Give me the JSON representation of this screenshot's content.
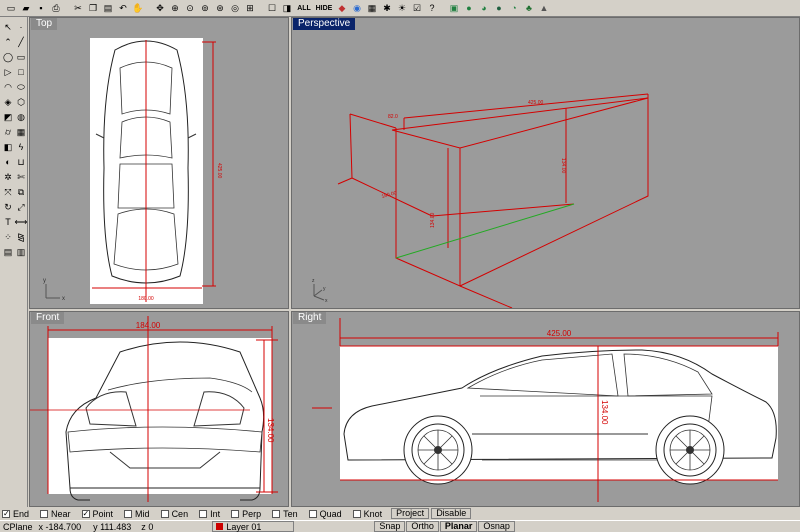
{
  "colors": {
    "accent": "#0a246a",
    "dimension": "#d40000",
    "axis_green": "#22aa22",
    "viewport_bg": "#9b9b9b"
  },
  "toolbar": {
    "icons": [
      "new-file-icon",
      "open-file-icon",
      "save-icon",
      "print-icon",
      "cut-icon",
      "copy-icon",
      "paste-icon",
      "undo-icon",
      "pan-icon",
      "zoom-in-icon",
      "zoom-icon",
      "zoom-extents-icon",
      "zoom-window-icon",
      "grid-icon",
      "snap-icon",
      "ortho-icon",
      "rotate-view-icon",
      "properties-icon",
      "layer-icon",
      "render-icon",
      "shade-icon",
      "light-icon",
      "options-icon",
      "help-icon"
    ],
    "labels": {
      "all": "ALL",
      "hide": "HIDE"
    }
  },
  "viewports": {
    "top": {
      "title": "Top",
      "dim_width": "180.00",
      "dim_length": "425.00",
      "axis_x": "x",
      "axis_y": "y"
    },
    "perspective": {
      "title": "Perspective",
      "dim_top_length": "425.00",
      "dim_width": "180.00",
      "dim_height": "134.00",
      "dim_height_2": "134.00",
      "dim_small": "82.0",
      "axis_x": "x",
      "axis_y": "y",
      "axis_z": "z"
    },
    "front": {
      "title": "Front",
      "dim_width": "184.00",
      "dim_height": "134.00"
    },
    "right": {
      "title": "Right",
      "dim_length": "425.00",
      "dim_height": "134.00"
    }
  },
  "osnap": {
    "items": [
      {
        "label": "End",
        "checked": true
      },
      {
        "label": "Near",
        "checked": false
      },
      {
        "label": "Point",
        "checked": true
      },
      {
        "label": "Mid",
        "checked": false
      },
      {
        "label": "Cen",
        "checked": false
      },
      {
        "label": "Int",
        "checked": false
      },
      {
        "label": "Perp",
        "checked": false
      },
      {
        "label": "Ten",
        "checked": false
      },
      {
        "label": "Quad",
        "checked": false
      },
      {
        "label": "Knot",
        "checked": false
      }
    ],
    "project_label": "Project",
    "disable_label": "Disable"
  },
  "status": {
    "cplane_label": "CPlane",
    "x_label": "x",
    "x_value": "-184.700",
    "y_label": "y",
    "y_value": "111.483",
    "z_label": "z",
    "z_value": "0",
    "layer_name": "Layer 01",
    "layer_color": "#cc0000",
    "snap_label": "Snap",
    "ortho_label": "Ortho",
    "planar_label": "Planar",
    "osnap_label": "Osnap"
  }
}
